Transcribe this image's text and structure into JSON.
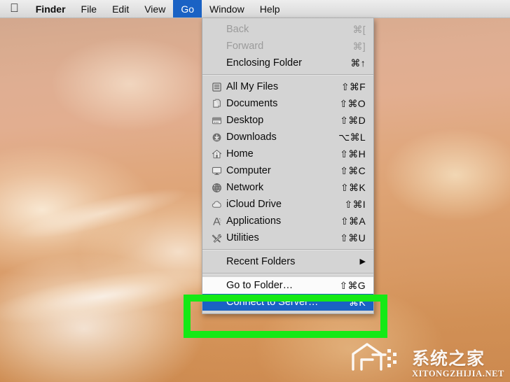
{
  "menubar": {
    "apple_icon": "apple-logo-icon",
    "items": [
      {
        "label": "Finder",
        "bold": true,
        "active": false
      },
      {
        "label": "File",
        "bold": false,
        "active": false
      },
      {
        "label": "Edit",
        "bold": false,
        "active": false
      },
      {
        "label": "View",
        "bold": false,
        "active": false
      },
      {
        "label": "Go",
        "bold": false,
        "active": true
      },
      {
        "label": "Window",
        "bold": false,
        "active": false
      },
      {
        "label": "Help",
        "bold": false,
        "active": false
      }
    ]
  },
  "go_menu": {
    "groups": [
      {
        "items": [
          {
            "label": "Back",
            "shortcut": "⌘[",
            "icon": null,
            "state": "disabled"
          },
          {
            "label": "Forward",
            "shortcut": "⌘]",
            "icon": null,
            "state": "disabled"
          },
          {
            "label": "Enclosing Folder",
            "shortcut": "⌘↑",
            "icon": null,
            "state": "normal"
          }
        ]
      },
      {
        "items": [
          {
            "label": "All My Files",
            "shortcut": "⇧⌘F",
            "icon": "all-my-files-icon",
            "state": "normal"
          },
          {
            "label": "Documents",
            "shortcut": "⇧⌘O",
            "icon": "documents-icon",
            "state": "normal"
          },
          {
            "label": "Desktop",
            "shortcut": "⇧⌘D",
            "icon": "desktop-icon",
            "state": "normal"
          },
          {
            "label": "Downloads",
            "shortcut": "⌥⌘L",
            "icon": "downloads-icon",
            "state": "normal"
          },
          {
            "label": "Home",
            "shortcut": "⇧⌘H",
            "icon": "home-icon",
            "state": "normal"
          },
          {
            "label": "Computer",
            "shortcut": "⇧⌘C",
            "icon": "computer-icon",
            "state": "normal"
          },
          {
            "label": "Network",
            "shortcut": "⇧⌘K",
            "icon": "network-globe-icon",
            "state": "normal"
          },
          {
            "label": "iCloud Drive",
            "shortcut": "⇧⌘I",
            "icon": "icloud-drive-icon",
            "state": "normal"
          },
          {
            "label": "Applications",
            "shortcut": "⇧⌘A",
            "icon": "applications-icon",
            "state": "normal"
          },
          {
            "label": "Utilities",
            "shortcut": "⇧⌘U",
            "icon": "utilities-icon",
            "state": "normal"
          }
        ]
      },
      {
        "items": [
          {
            "label": "Recent Folders",
            "shortcut": "",
            "icon": null,
            "state": "submenu",
            "arrow": "▶"
          }
        ]
      },
      {
        "items": [
          {
            "label": "Go to Folder…",
            "shortcut": "⇧⌘G",
            "icon": null,
            "state": "normal"
          },
          {
            "label": "Connect to Server…",
            "shortcut": "⌘K",
            "icon": null,
            "state": "selected"
          }
        ]
      }
    ]
  },
  "annotation": {
    "name": "highlight-box",
    "color": "#15e916"
  },
  "watermark": {
    "chinese": "系统之家",
    "english": "XITONGZHIJIA.NET"
  },
  "colors": {
    "menu_highlight": "#1a62c4",
    "menu_background": "#d4d4d4",
    "menubar_text": "#0d0d0d",
    "annotation_green": "#15e916"
  }
}
